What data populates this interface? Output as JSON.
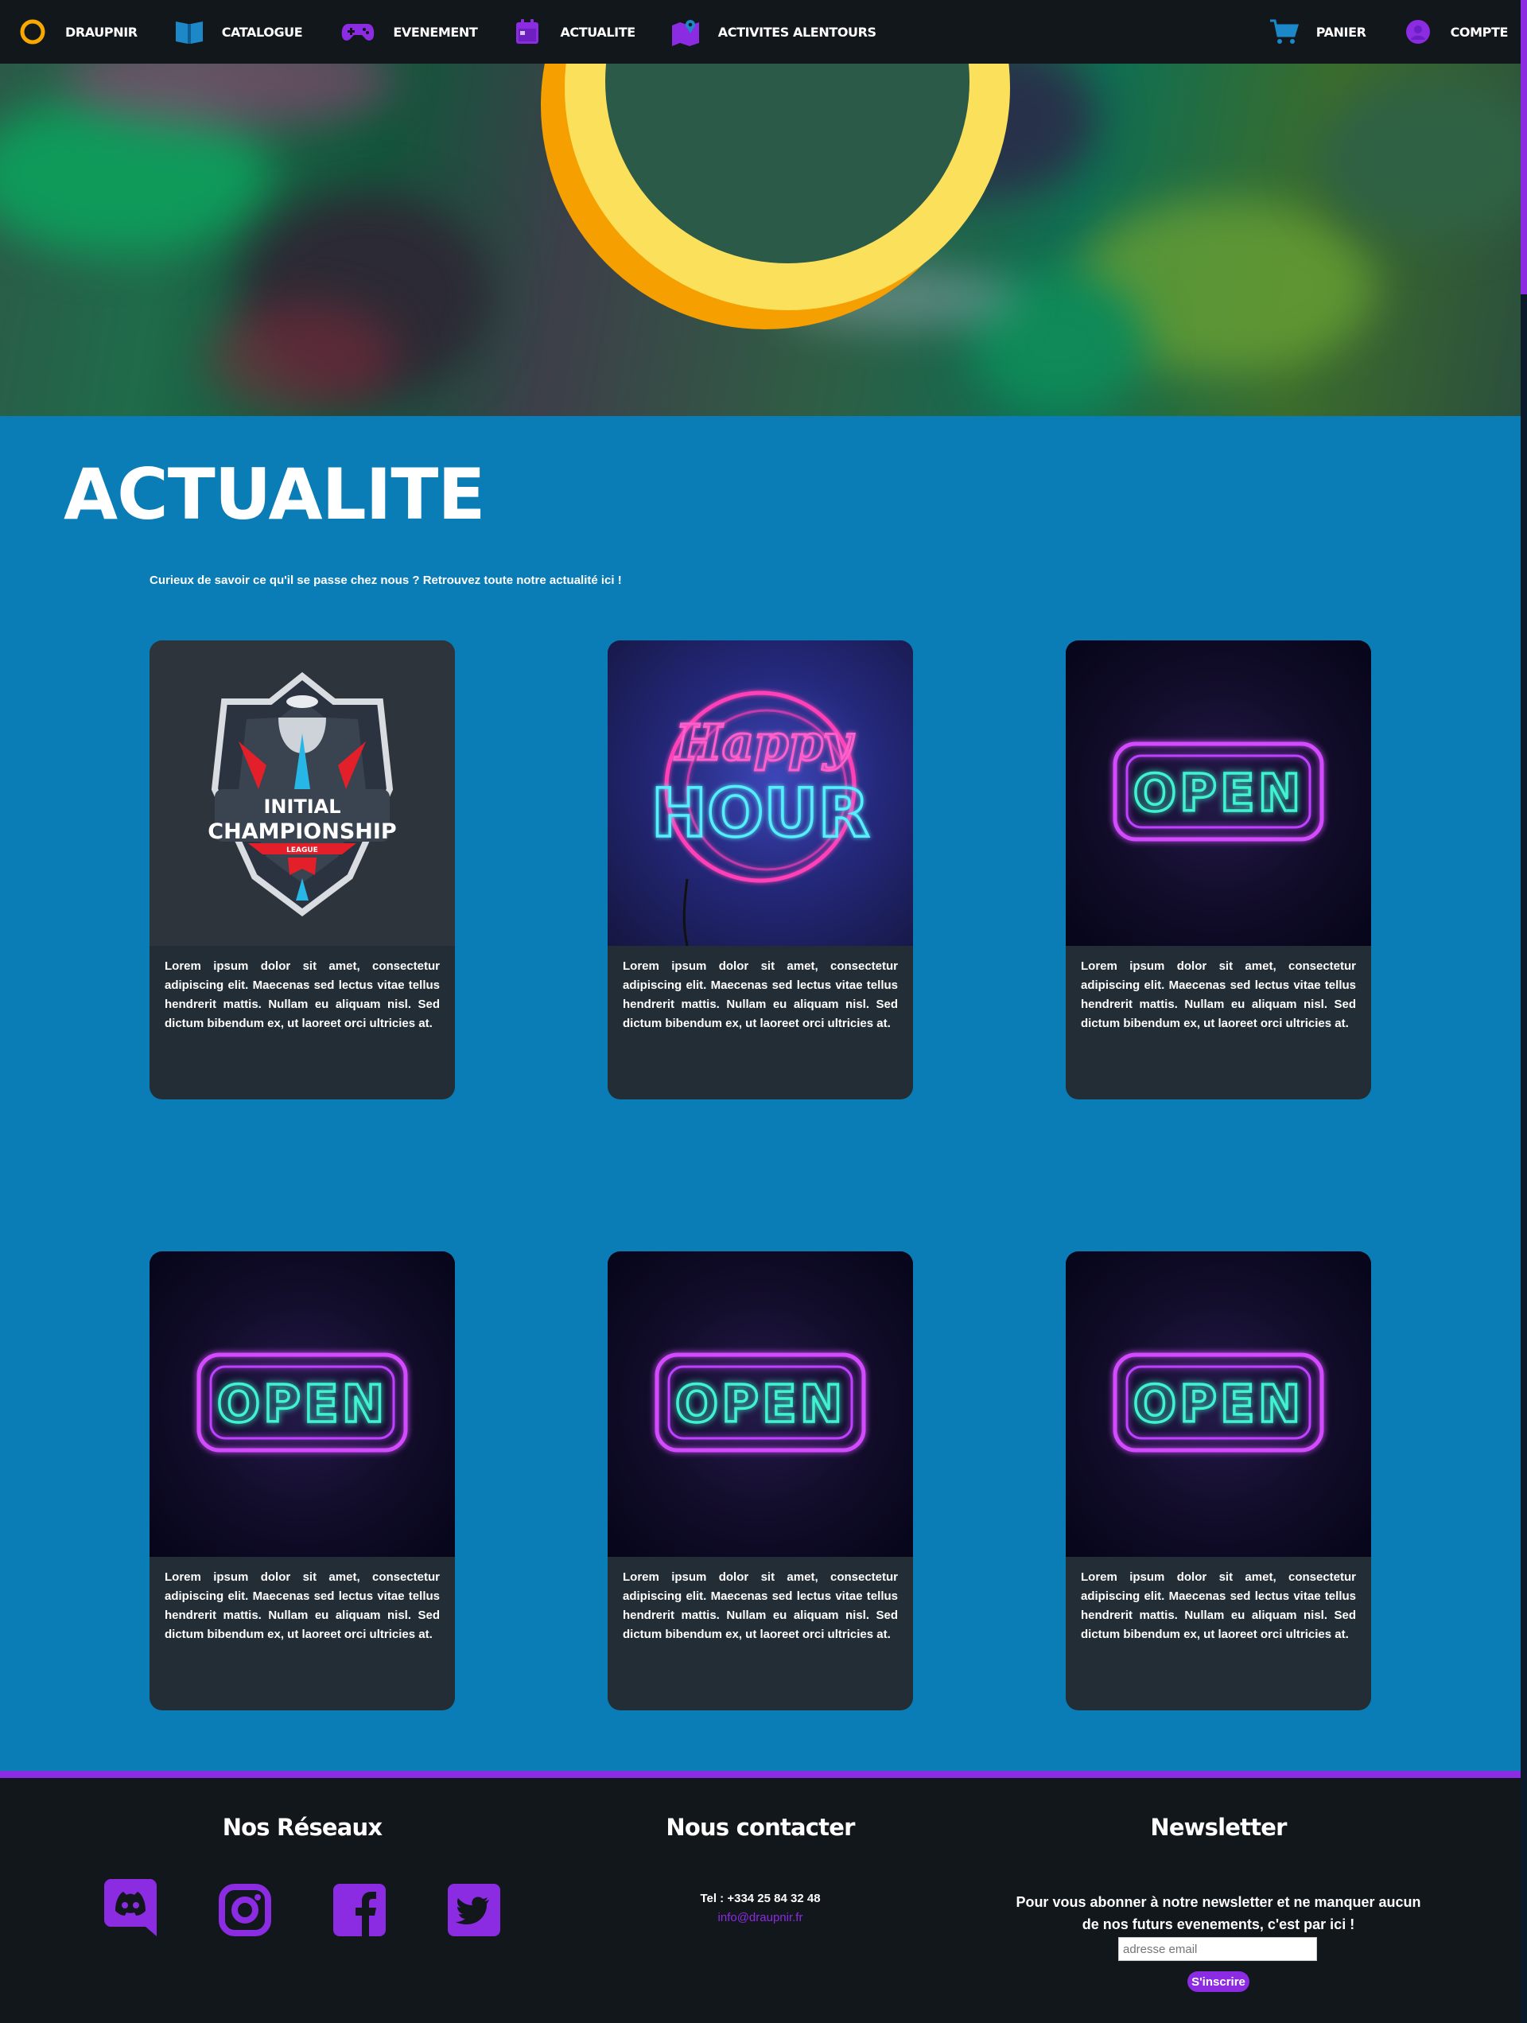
{
  "nav": {
    "brand": "DRAUPNIR",
    "items": [
      {
        "label": "CATALOGUE",
        "icon": "book-icon"
      },
      {
        "label": "EVENEMENT",
        "icon": "gamepad-icon"
      },
      {
        "label": "ACTUALITE",
        "icon": "calendar-icon"
      },
      {
        "label": "ACTIVITES ALENTOURS",
        "icon": "map-icon"
      }
    ],
    "cart": "PANIER",
    "account": "COMPTE"
  },
  "main": {
    "title": "ACTUALITE",
    "intro": "Curieux de savoir ce qu'il se passe chez nous ? Retrouvez toute notre actualité ici !",
    "cards": [
      {
        "image": "championship-logo",
        "text": "Lorem ipsum dolor sit amet, consectetur adipiscing elit. Maecenas sed lectus vitae tellus hendrerit mattis. Nullam eu aliquam nisl. Sed dictum bibendum ex, ut laoreet orci ultricies at."
      },
      {
        "image": "happy-hour-neon",
        "text": "Lorem ipsum dolor sit amet, consectetur adipiscing elit. Maecenas sed lectus vitae tellus hendrerit mattis. Nullam eu aliquam nisl. Sed dictum bibendum ex, ut laoreet orci ultricies at."
      },
      {
        "image": "open-neon",
        "text": "Lorem ipsum dolor sit amet, consectetur adipiscing elit. Maecenas sed lectus vitae tellus hendrerit mattis. Nullam eu aliquam nisl. Sed dictum bibendum ex, ut laoreet orci ultricies at."
      },
      {
        "image": "open-neon",
        "text": "Lorem ipsum dolor sit amet, consectetur adipiscing elit. Maecenas sed lectus vitae tellus hendrerit mattis. Nullam eu aliquam nisl. Sed dictum bibendum ex, ut laoreet orci ultricies at."
      },
      {
        "image": "open-neon",
        "text": "Lorem ipsum dolor sit amet, consectetur adipiscing elit. Maecenas sed lectus vitae tellus hendrerit mattis. Nullam eu aliquam nisl. Sed dictum bibendum ex, ut laoreet orci ultricies at."
      },
      {
        "image": "open-neon",
        "text": "Lorem ipsum dolor sit amet, consectetur adipiscing elit. Maecenas sed lectus vitae tellus hendrerit mattis. Nullam eu aliquam nisl. Sed dictum bibendum ex, ut laoreet orci ultricies at."
      }
    ],
    "neon": {
      "happy": "Happy",
      "hour": "HOUR",
      "open": "OPEN"
    },
    "logo": {
      "line1": "INITIAL",
      "line2": "CHAMPIONSHIP",
      "line3": "LEAGUE"
    }
  },
  "footer": {
    "networks_title": "Nos Réseaux",
    "contact_title": "Nous contacter",
    "newsletter_title": "Newsletter",
    "tel": "Tel : +334 25 84 32 48",
    "email": "info@draupnir.fr",
    "newsletter_text": "Pour vous abonner à notre newsletter et ne manquer aucun de nos futurs evenements, c'est par ici !",
    "email_placeholder": "adresse email",
    "subscribe": "S'inscrire"
  },
  "colors": {
    "accent": "#8b2be2",
    "background": "#0a7cb6",
    "nav": "#12171c",
    "card": "#222d35",
    "ring": "#f8a800"
  }
}
